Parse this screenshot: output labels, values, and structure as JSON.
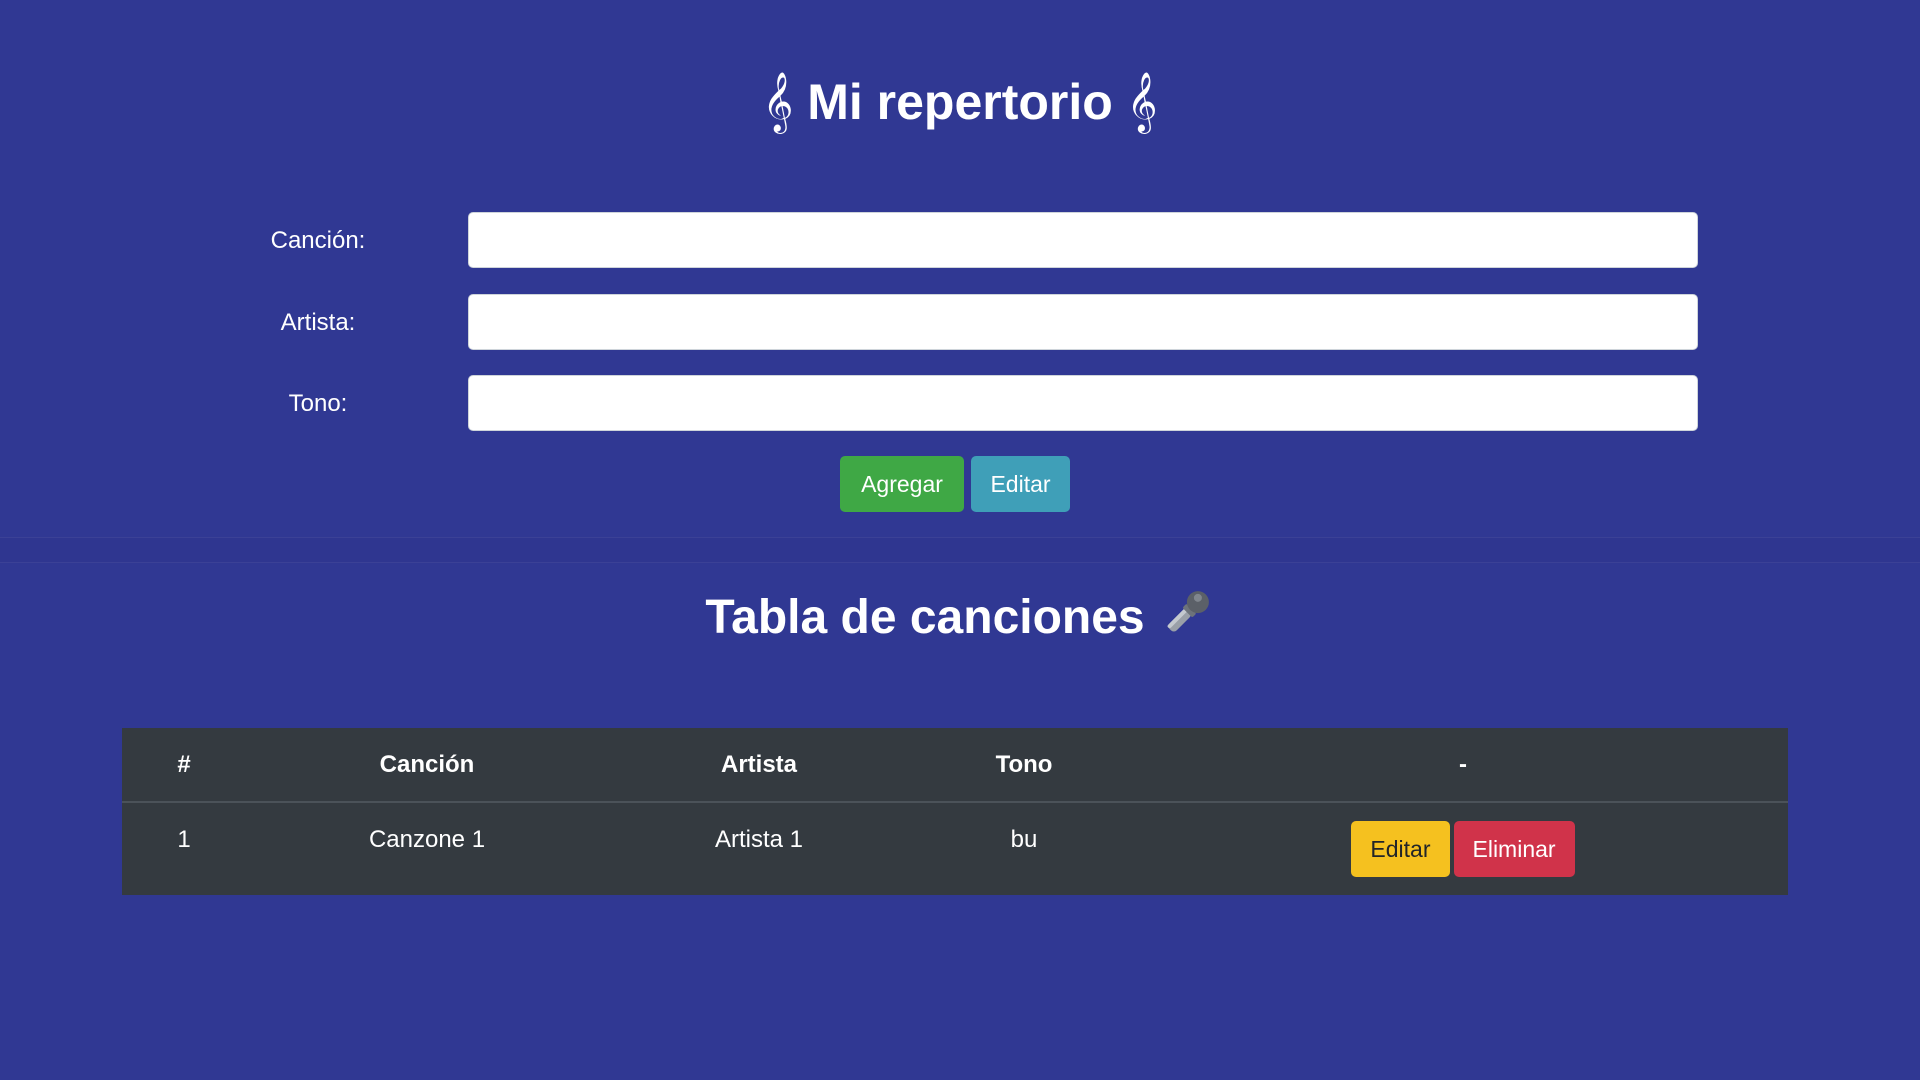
{
  "header": {
    "title": "Mi repertorio",
    "clef_symbol": "𝄞"
  },
  "form": {
    "fields": [
      {
        "label": "Canción:",
        "value": "",
        "placeholder": ""
      },
      {
        "label": "Artista:",
        "value": "",
        "placeholder": ""
      },
      {
        "label": "Tono:",
        "value": "",
        "placeholder": ""
      }
    ],
    "add_label": "Agregar",
    "edit_label": "Editar"
  },
  "table_section": {
    "title": "Tabla de canciones",
    "icon": "microphone-icon",
    "columns": [
      "#",
      "Canción",
      "Artista",
      "Tono",
      "-"
    ],
    "rows": [
      {
        "number": "1",
        "song": "Canzone 1",
        "artist": "Artista 1",
        "tone": "bu",
        "edit_label": "Editar",
        "delete_label": "Eliminar"
      }
    ]
  },
  "colors": {
    "background": "#303893",
    "table_background": "#343a40",
    "success": "#3fa845",
    "info": "#3f9fb8",
    "warning": "#f5c11f",
    "danger": "#d0334a"
  }
}
